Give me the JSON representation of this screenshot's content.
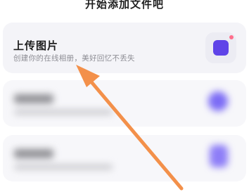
{
  "header": {
    "title": "开始添加文件吧"
  },
  "upload_card": {
    "title": "上传图片",
    "subtitle": "创建你的在线相册，美好回忆不丢失",
    "icon": "image-upload-icon",
    "icon_color": "#5f44e8",
    "icon_accent_color": "#ff6f8c"
  },
  "blurred_cards": {
    "count_visible": 2,
    "icon_color": "#7c6cf5"
  },
  "overlay": {
    "arrow_icon": "pointer-arrow-icon",
    "arrow_color": "#f3904a"
  }
}
